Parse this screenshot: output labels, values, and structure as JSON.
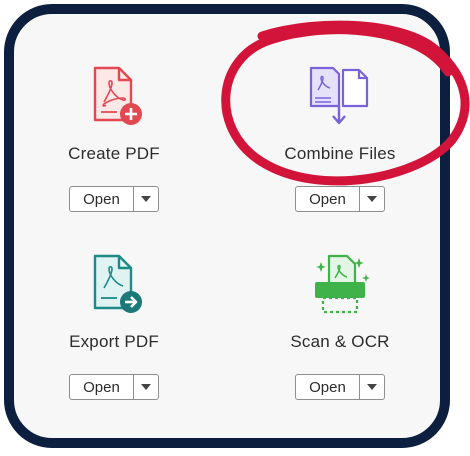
{
  "tools": [
    {
      "label": "Create PDF",
      "button": "Open",
      "icon": "create-pdf-icon",
      "accent": "#e2484f"
    },
    {
      "label": "Combine Files",
      "button": "Open",
      "icon": "combine-files-icon",
      "accent": "#7a63d9"
    },
    {
      "label": "Export PDF",
      "button": "Open",
      "icon": "export-pdf-icon",
      "accent": "#1d8a8a"
    },
    {
      "label": "Scan & OCR",
      "button": "Open",
      "icon": "scan-ocr-icon",
      "accent": "#3fb24a"
    }
  ],
  "colors": {
    "frame": "#0c1f3f",
    "panel": "#f7f7f7",
    "annotation_circle": "#d3143a"
  }
}
